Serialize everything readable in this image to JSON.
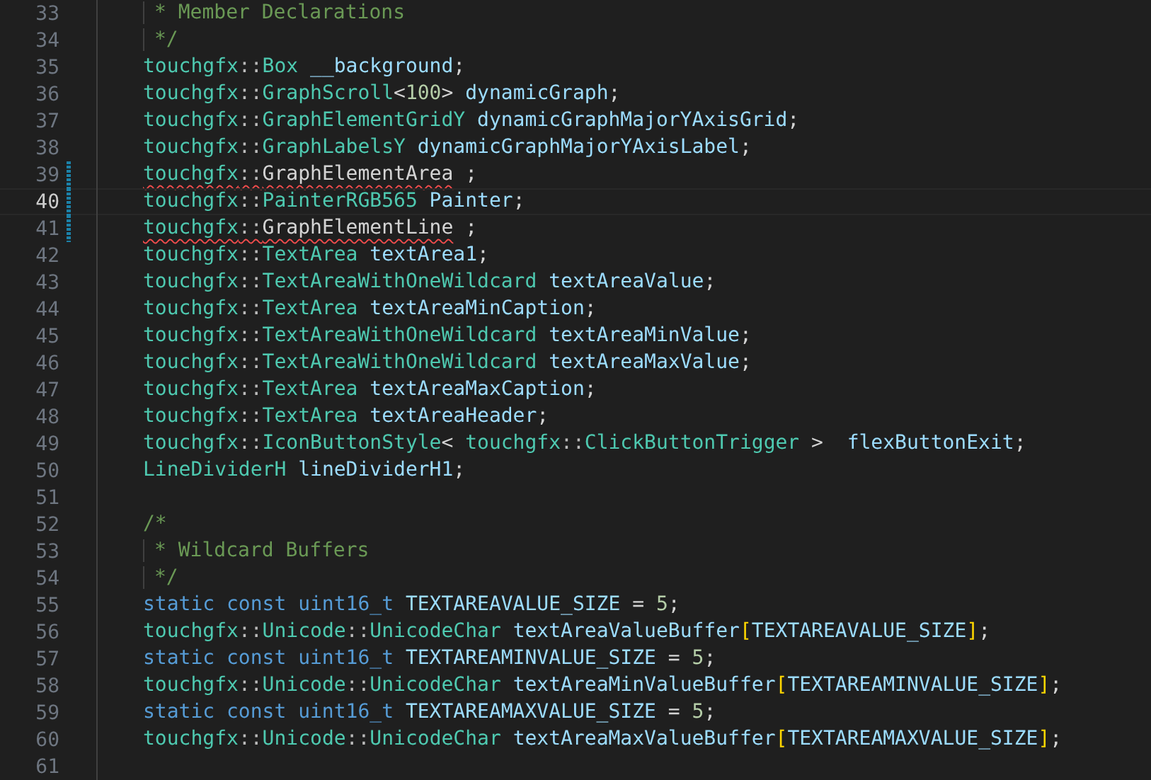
{
  "editor": {
    "lines": [
      {
        "number": "33",
        "current": false,
        "modified": false,
        "tokens": [
          {
            "text": "* Member Declarations",
            "kind": "comment-body"
          }
        ]
      },
      {
        "number": "34",
        "current": false,
        "modified": false,
        "tokens": [
          {
            "text": "*/",
            "kind": "comment-body"
          }
        ]
      },
      {
        "number": "35",
        "current": false,
        "modified": false,
        "tokens": [
          {
            "text": "touchgfx",
            "kind": "ns"
          },
          {
            "text": "::",
            "kind": "sep"
          },
          {
            "text": "Box",
            "kind": "type"
          },
          {
            "text": " __background",
            "kind": "var"
          },
          {
            "text": ";",
            "kind": "punct"
          }
        ]
      },
      {
        "number": "36",
        "current": false,
        "modified": false,
        "tokens": [
          {
            "text": "touchgfx",
            "kind": "ns"
          },
          {
            "text": "::",
            "kind": "sep"
          },
          {
            "text": "GraphScroll",
            "kind": "type"
          },
          {
            "text": "<",
            "kind": "punct"
          },
          {
            "text": "100",
            "kind": "number"
          },
          {
            "text": ">",
            "kind": "punct"
          },
          {
            "text": " dynamicGraph",
            "kind": "var"
          },
          {
            "text": ";",
            "kind": "punct"
          }
        ]
      },
      {
        "number": "37",
        "current": false,
        "modified": false,
        "tokens": [
          {
            "text": "touchgfx",
            "kind": "ns"
          },
          {
            "text": "::",
            "kind": "sep"
          },
          {
            "text": "GraphElementGridY",
            "kind": "type"
          },
          {
            "text": " dynamicGraphMajorYAxisGrid",
            "kind": "var"
          },
          {
            "text": ";",
            "kind": "punct"
          }
        ]
      },
      {
        "number": "38",
        "current": false,
        "modified": false,
        "tokens": [
          {
            "text": "touchgfx",
            "kind": "ns"
          },
          {
            "text": "::",
            "kind": "sep"
          },
          {
            "text": "GraphLabelsY",
            "kind": "type"
          },
          {
            "text": " dynamicGraphMajorYAxisLabel",
            "kind": "var"
          },
          {
            "text": ";",
            "kind": "punct"
          }
        ]
      },
      {
        "number": "39",
        "current": false,
        "modified": true,
        "tokens": [
          {
            "text": "touchgfx",
            "kind": "ns",
            "error": true
          },
          {
            "text": "::",
            "kind": "sep",
            "error": true
          },
          {
            "text": "GraphElementArea",
            "kind": "plain",
            "error": true
          },
          {
            "text": " ;",
            "kind": "punct",
            "error": false
          }
        ]
      },
      {
        "number": "40",
        "current": true,
        "modified": true,
        "tokens": [
          {
            "text": "touchgfx",
            "kind": "ns"
          },
          {
            "text": "::",
            "kind": "sep"
          },
          {
            "text": "PainterRGB565",
            "kind": "type"
          },
          {
            "text": " Painter",
            "kind": "var"
          },
          {
            "text": ";",
            "kind": "punct"
          }
        ]
      },
      {
        "number": "41",
        "current": false,
        "modified": true,
        "tokens": [
          {
            "text": "touchgfx",
            "kind": "ns",
            "error": true
          },
          {
            "text": "::",
            "kind": "sep",
            "error": true
          },
          {
            "text": "GraphElementLine",
            "kind": "plain",
            "error": true
          },
          {
            "text": " ;",
            "kind": "punct",
            "error": false
          }
        ]
      },
      {
        "number": "42",
        "current": false,
        "modified": false,
        "tokens": [
          {
            "text": "touchgfx",
            "kind": "ns"
          },
          {
            "text": "::",
            "kind": "sep"
          },
          {
            "text": "TextArea",
            "kind": "type"
          },
          {
            "text": " textArea1",
            "kind": "var"
          },
          {
            "text": ";",
            "kind": "punct"
          }
        ]
      },
      {
        "number": "43",
        "current": false,
        "modified": false,
        "tokens": [
          {
            "text": "touchgfx",
            "kind": "ns"
          },
          {
            "text": "::",
            "kind": "sep"
          },
          {
            "text": "TextAreaWithOneWildcard",
            "kind": "type"
          },
          {
            "text": " textAreaValue",
            "kind": "var"
          },
          {
            "text": ";",
            "kind": "punct"
          }
        ]
      },
      {
        "number": "44",
        "current": false,
        "modified": false,
        "tokens": [
          {
            "text": "touchgfx",
            "kind": "ns"
          },
          {
            "text": "::",
            "kind": "sep"
          },
          {
            "text": "TextArea",
            "kind": "type"
          },
          {
            "text": " textAreaMinCaption",
            "kind": "var"
          },
          {
            "text": ";",
            "kind": "punct"
          }
        ]
      },
      {
        "number": "45",
        "current": false,
        "modified": false,
        "tokens": [
          {
            "text": "touchgfx",
            "kind": "ns"
          },
          {
            "text": "::",
            "kind": "sep"
          },
          {
            "text": "TextAreaWithOneWildcard",
            "kind": "type"
          },
          {
            "text": " textAreaMinValue",
            "kind": "var"
          },
          {
            "text": ";",
            "kind": "punct"
          }
        ]
      },
      {
        "number": "46",
        "current": false,
        "modified": false,
        "tokens": [
          {
            "text": "touchgfx",
            "kind": "ns"
          },
          {
            "text": "::",
            "kind": "sep"
          },
          {
            "text": "TextAreaWithOneWildcard",
            "kind": "type"
          },
          {
            "text": " textAreaMaxValue",
            "kind": "var"
          },
          {
            "text": ";",
            "kind": "punct"
          }
        ]
      },
      {
        "number": "47",
        "current": false,
        "modified": false,
        "tokens": [
          {
            "text": "touchgfx",
            "kind": "ns"
          },
          {
            "text": "::",
            "kind": "sep"
          },
          {
            "text": "TextArea",
            "kind": "type"
          },
          {
            "text": " textAreaMaxCaption",
            "kind": "var"
          },
          {
            "text": ";",
            "kind": "punct"
          }
        ]
      },
      {
        "number": "48",
        "current": false,
        "modified": false,
        "tokens": [
          {
            "text": "touchgfx",
            "kind": "ns"
          },
          {
            "text": "::",
            "kind": "sep"
          },
          {
            "text": "TextArea",
            "kind": "type"
          },
          {
            "text": " textAreaHeader",
            "kind": "var"
          },
          {
            "text": ";",
            "kind": "punct"
          }
        ]
      },
      {
        "number": "49",
        "current": false,
        "modified": false,
        "tokens": [
          {
            "text": "touchgfx",
            "kind": "ns"
          },
          {
            "text": "::",
            "kind": "sep"
          },
          {
            "text": "IconButtonStyle",
            "kind": "type"
          },
          {
            "text": "< ",
            "kind": "punct"
          },
          {
            "text": "touchgfx",
            "kind": "ns"
          },
          {
            "text": "::",
            "kind": "sep"
          },
          {
            "text": "ClickButtonTrigger",
            "kind": "type"
          },
          {
            "text": " >  ",
            "kind": "punct"
          },
          {
            "text": "flexButtonExit",
            "kind": "var"
          },
          {
            "text": ";",
            "kind": "punct"
          }
        ]
      },
      {
        "number": "50",
        "current": false,
        "modified": false,
        "tokens": [
          {
            "text": "LineDividerH",
            "kind": "type"
          },
          {
            "text": " lineDividerH1",
            "kind": "var"
          },
          {
            "text": ";",
            "kind": "punct"
          }
        ]
      },
      {
        "number": "51",
        "current": false,
        "modified": false
      },
      {
        "number": "52",
        "current": false,
        "modified": false,
        "tokens": [
          {
            "text": "/*",
            "kind": "comment"
          }
        ]
      },
      {
        "number": "53",
        "current": false,
        "modified": false,
        "tokens": [
          {
            "text": "* Wildcard Buffers",
            "kind": "comment-body"
          }
        ]
      },
      {
        "number": "54",
        "current": false,
        "modified": false,
        "tokens": [
          {
            "text": "*/",
            "kind": "comment-body"
          }
        ]
      },
      {
        "number": "55",
        "current": false,
        "modified": false,
        "tokens": [
          {
            "text": "static const ",
            "kind": "keyword"
          },
          {
            "text": "uint16_t",
            "kind": "keyword"
          },
          {
            "text": " TEXTAREAVALUE_SIZE",
            "kind": "var"
          },
          {
            "text": " = ",
            "kind": "punct"
          },
          {
            "text": "5",
            "kind": "number"
          },
          {
            "text": ";",
            "kind": "punct"
          }
        ]
      },
      {
        "number": "56",
        "current": false,
        "modified": false,
        "tokens": [
          {
            "text": "touchgfx",
            "kind": "ns"
          },
          {
            "text": "::",
            "kind": "sep"
          },
          {
            "text": "Unicode",
            "kind": "type"
          },
          {
            "text": "::",
            "kind": "sep"
          },
          {
            "text": "UnicodeChar",
            "kind": "type"
          },
          {
            "text": " textAreaValueBuffer",
            "kind": "var"
          },
          {
            "text": "[",
            "kind": "bracket"
          },
          {
            "text": "TEXTAREAVALUE_SIZE",
            "kind": "var"
          },
          {
            "text": "]",
            "kind": "bracket"
          },
          {
            "text": ";",
            "kind": "punct"
          }
        ]
      },
      {
        "number": "57",
        "current": false,
        "modified": false,
        "tokens": [
          {
            "text": "static const ",
            "kind": "keyword"
          },
          {
            "text": "uint16_t",
            "kind": "keyword"
          },
          {
            "text": " TEXTAREAMINVALUE_SIZE",
            "kind": "var"
          },
          {
            "text": " = ",
            "kind": "punct"
          },
          {
            "text": "5",
            "kind": "number"
          },
          {
            "text": ";",
            "kind": "punct"
          }
        ]
      },
      {
        "number": "58",
        "current": false,
        "modified": false,
        "tokens": [
          {
            "text": "touchgfx",
            "kind": "ns"
          },
          {
            "text": "::",
            "kind": "sep"
          },
          {
            "text": "Unicode",
            "kind": "type"
          },
          {
            "text": "::",
            "kind": "sep"
          },
          {
            "text": "UnicodeChar",
            "kind": "type"
          },
          {
            "text": " textAreaMinValueBuffer",
            "kind": "var"
          },
          {
            "text": "[",
            "kind": "bracket"
          },
          {
            "text": "TEXTAREAMINVALUE_SIZE",
            "kind": "var"
          },
          {
            "text": "]",
            "kind": "bracket"
          },
          {
            "text": ";",
            "kind": "punct"
          }
        ]
      },
      {
        "number": "59",
        "current": false,
        "modified": false,
        "tokens": [
          {
            "text": "static const ",
            "kind": "keyword"
          },
          {
            "text": "uint16_t",
            "kind": "keyword"
          },
          {
            "text": " TEXTAREAMAXVALUE_SIZE",
            "kind": "var"
          },
          {
            "text": " = ",
            "kind": "punct"
          },
          {
            "text": "5",
            "kind": "number"
          },
          {
            "text": ";",
            "kind": "punct"
          }
        ]
      },
      {
        "number": "60",
        "current": false,
        "modified": false,
        "tokens": [
          {
            "text": "touchgfx",
            "kind": "ns"
          },
          {
            "text": "::",
            "kind": "sep"
          },
          {
            "text": "Unicode",
            "kind": "type"
          },
          {
            "text": "::",
            "kind": "sep"
          },
          {
            "text": "UnicodeChar",
            "kind": "type"
          },
          {
            "text": " textAreaMaxValueBuffer",
            "kind": "var"
          },
          {
            "text": "[",
            "kind": "bracket"
          },
          {
            "text": "TEXTAREAMAXVALUE_SIZE",
            "kind": "var"
          },
          {
            "text": "]",
            "kind": "bracket"
          },
          {
            "text": ";",
            "kind": "punct"
          }
        ]
      },
      {
        "number": "61",
        "current": false,
        "modified": false
      }
    ]
  }
}
